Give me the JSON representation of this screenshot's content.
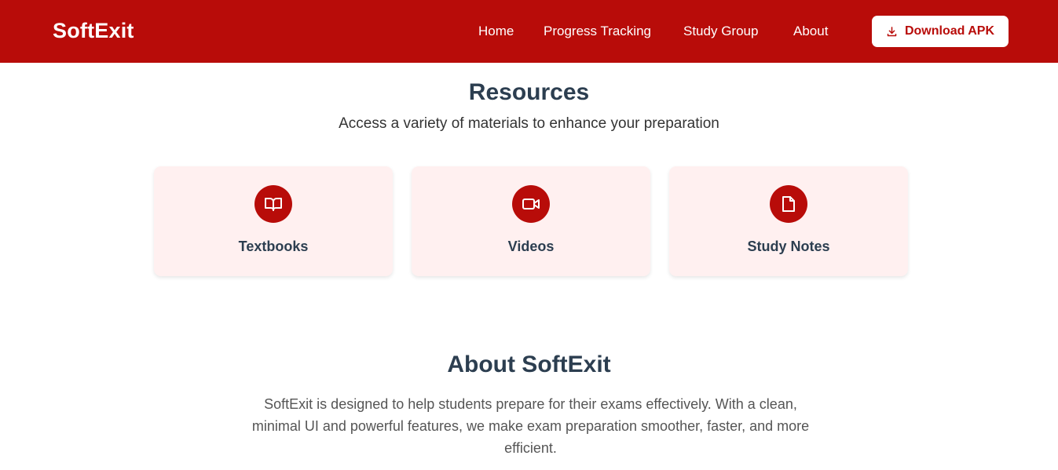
{
  "colors": {
    "primary": "#b80c09",
    "heading": "#2c3e50",
    "card_background": "#fff0f0",
    "white": "#ffffff"
  },
  "navbar": {
    "logo": "SoftExit",
    "links": [
      {
        "label": "Home"
      },
      {
        "label": "Progress Tracking"
      },
      {
        "label": "Study Group"
      },
      {
        "label": "About"
      }
    ],
    "download": {
      "label": "Download APK",
      "icon": "download-icon"
    }
  },
  "resources": {
    "title": "Resources",
    "subtitle": "Access a variety of materials to enhance your preparation",
    "cards": [
      {
        "label": "Textbooks",
        "icon": "book-icon"
      },
      {
        "label": "Videos",
        "icon": "video-icon"
      },
      {
        "label": "Study Notes",
        "icon": "note-icon"
      }
    ]
  },
  "about": {
    "title": "About SoftExit",
    "text": "SoftExit is designed to help students prepare for their exams effectively. With a clean, minimal UI and powerful features, we make exam preparation smoother, faster, and more efficient."
  }
}
